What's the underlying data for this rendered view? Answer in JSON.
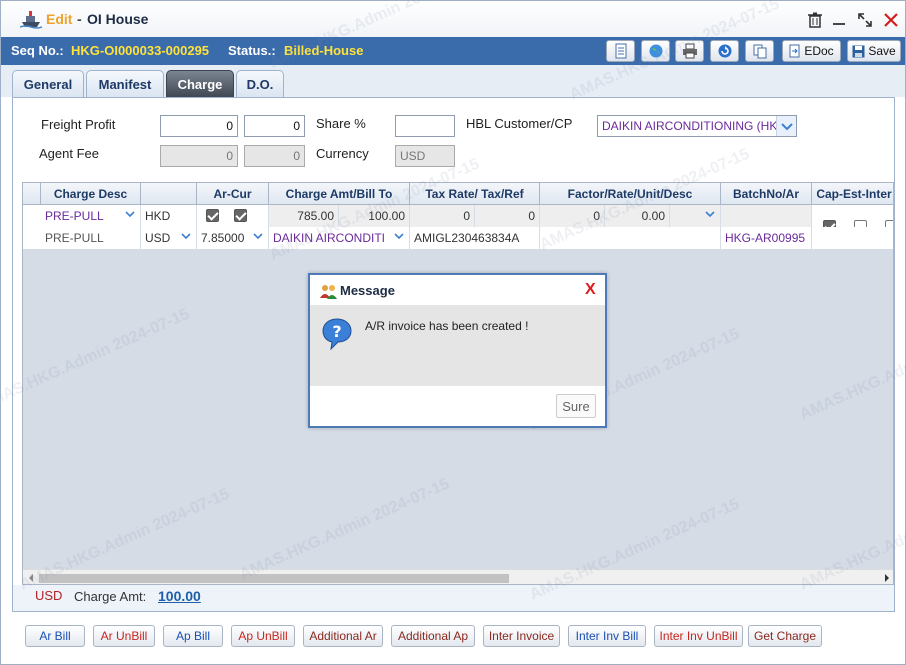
{
  "window": {
    "mode": "Edit",
    "separator": "-",
    "title": "OI House"
  },
  "seq": {
    "seq_label": "Seq No.:",
    "seq_value": "HKG-OI000033-000295",
    "status_label": "Status.:",
    "status_value": "Billed-House"
  },
  "toolbar": {
    "edoc_label": "EDoc",
    "save_label": "Save"
  },
  "tabs": [
    {
      "label": "General"
    },
    {
      "label": "Manifest"
    },
    {
      "label": "Charge"
    },
    {
      "label": "D.O."
    }
  ],
  "form": {
    "freight_profit_label": "Freight Profit",
    "freight_profit_1": "0",
    "freight_profit_2": "0",
    "share_label": "Share %",
    "share_value": "",
    "hbl_customer_label": "HBL Customer/CP",
    "hbl_customer_value": "DAIKIN AIRCONDITIONING (HK",
    "agent_fee_label": "Agent Fee",
    "agent_fee_1": "0",
    "agent_fee_2": "0",
    "currency_label": "Currency",
    "currency_value": "USD"
  },
  "grid": {
    "headers": [
      "Charge Desc",
      "Ar-Cur",
      "Charge Amt/Bill To",
      "Tax Rate/ Tax/Ref",
      "Factor/Rate/Unit/Desc",
      "BatchNo/Ar",
      "Cap-Est-Inter"
    ],
    "row1": {
      "charge_desc": "PRE-PULL",
      "cur": "HKD",
      "amt1": "785.00",
      "amt2": "100.00",
      "tax1": "0",
      "tax2": "0",
      "factor1": "0",
      "factor2": "0.00",
      "batch": ""
    },
    "row2": {
      "charge_desc": "PRE-PULL",
      "cur": "USD",
      "rate": "7.85000",
      "bill_to": "DAIKIN AIRCONDITI",
      "ref": "AMIGL230463834A",
      "ar_no": "HKG-AR00995"
    }
  },
  "footer": {
    "currency": "USD",
    "charge_amt_label": "Charge Amt:",
    "charge_amt_value": "100.00"
  },
  "bottom_buttons": [
    {
      "label": "Ar Bill",
      "color": "#1a4fb5"
    },
    {
      "label": "Ar UnBill",
      "color": "#c8261e"
    },
    {
      "label": "Ap Bill",
      "color": "#1a4fb5"
    },
    {
      "label": "Ap UnBill",
      "color": "#c8261e"
    },
    {
      "label": "Additional Ar",
      "color": "#8a2a20"
    },
    {
      "label": "Additional Ap",
      "color": "#8a2a20"
    },
    {
      "label": "Inter Invoice",
      "color": "#8a2a20"
    },
    {
      "label": "Inter Inv Bill",
      "color": "#1a4fb5"
    },
    {
      "label": "Inter Inv UnBill",
      "color": "#c8261e"
    },
    {
      "label": "Get Charge",
      "color": "#8a2a20"
    }
  ],
  "dialog": {
    "title": "Message",
    "close": "X",
    "message": "A/R invoice has been created !",
    "button": "Sure"
  },
  "watermark": "AMAS.HKG.Admin 2024-07-15",
  "colors": {
    "header_bar": "#3a6bab",
    "status_yellow": "#ffe23a",
    "accent_orange": "#f0a22a"
  }
}
